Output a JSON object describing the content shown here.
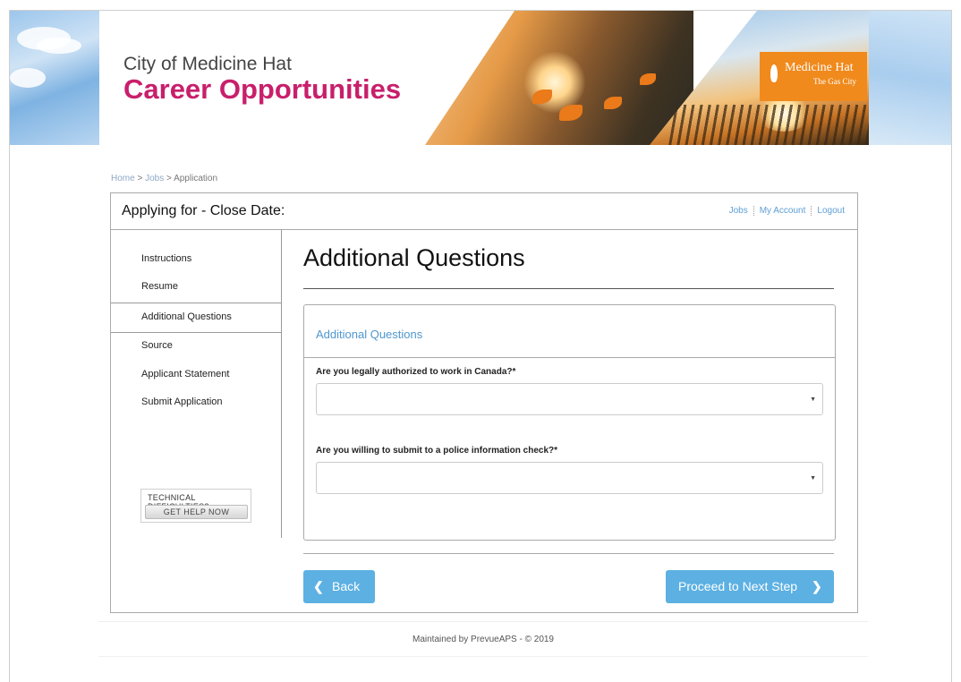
{
  "header": {
    "city": "City of Medicine Hat",
    "title": "Career Opportunities",
    "logo_name": "Medicine Hat",
    "logo_tagline": "The Gas City"
  },
  "breadcrumb": {
    "home": "Home",
    "sep1": ">",
    "jobs": "Jobs",
    "sep2": ">",
    "current": "Application"
  },
  "panel": {
    "applying_label": "Applying for - Close Date:",
    "top_links": [
      "Jobs",
      "My Account",
      "Logout"
    ]
  },
  "sidebar": {
    "items": [
      {
        "label": "Instructions"
      },
      {
        "label": "Resume"
      },
      {
        "label": "Additional Questions",
        "active": true
      },
      {
        "label": "Source"
      },
      {
        "label": "Applicant Statement"
      },
      {
        "label": "Submit Application"
      }
    ],
    "help_line1": "TECHNICAL DIFFICULTIES?",
    "help_line2": "GET HELP NOW"
  },
  "main": {
    "title": "Additional Questions",
    "box_title": "Additional Questions",
    "questions": [
      {
        "label": "Are you legally authorized to work in Canada?*",
        "value": ""
      },
      {
        "label": "Are you willing to submit to a police information check?*",
        "value": ""
      }
    ],
    "back_label": "Back",
    "next_label": "Proceed to Next Step"
  },
  "footer": {
    "text": "Maintained by PrevueAPS - © 2019"
  },
  "colors": {
    "brand_title": "#c81f6b",
    "accent_blue": "#5cb0e2",
    "link_blue": "#5d9ed4",
    "logo_orange": "#f08a1d"
  }
}
